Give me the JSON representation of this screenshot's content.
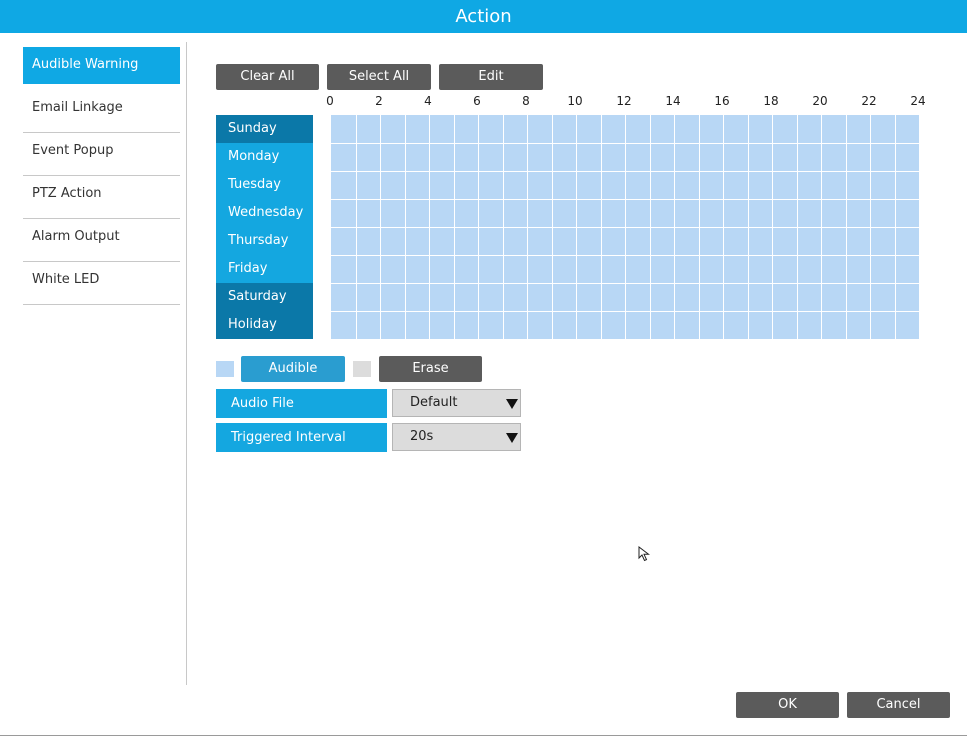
{
  "window": {
    "title": "Action"
  },
  "sidebar": {
    "items": [
      {
        "label": "Audible Warning",
        "active": true
      },
      {
        "label": "Email Linkage",
        "active": false
      },
      {
        "label": "Event Popup",
        "active": false
      },
      {
        "label": "PTZ Action",
        "active": false
      },
      {
        "label": "Alarm Output",
        "active": false
      },
      {
        "label": "White LED",
        "active": false
      }
    ]
  },
  "toolbar": {
    "clear_all": "Clear All",
    "select_all": "Select All",
    "edit": "Edit"
  },
  "schedule": {
    "hours": [
      "0",
      "2",
      "4",
      "6",
      "8",
      "10",
      "12",
      "14",
      "16",
      "18",
      "20",
      "22",
      "24"
    ],
    "days": [
      "Sunday",
      "Monday",
      "Tuesday",
      "Wednesday",
      "Thursday",
      "Friday",
      "Saturday",
      "Holiday"
    ],
    "selected_color": "#b8d7f5"
  },
  "legend": {
    "audible_label": "Audible",
    "audible_color": "#b8d7f5",
    "erase_label": "Erase",
    "erase_color": "#dcdcdc"
  },
  "settings": {
    "audio_file": {
      "label": "Audio File",
      "value": "Default"
    },
    "triggered_interval": {
      "label": "Triggered Interval",
      "value": "20s"
    }
  },
  "footer": {
    "ok_label": "OK",
    "cancel_label": "Cancel"
  },
  "colors": {
    "accent": "#0fa8e4",
    "day_dark": "#0b78a8",
    "button": "#5b5b5b"
  }
}
